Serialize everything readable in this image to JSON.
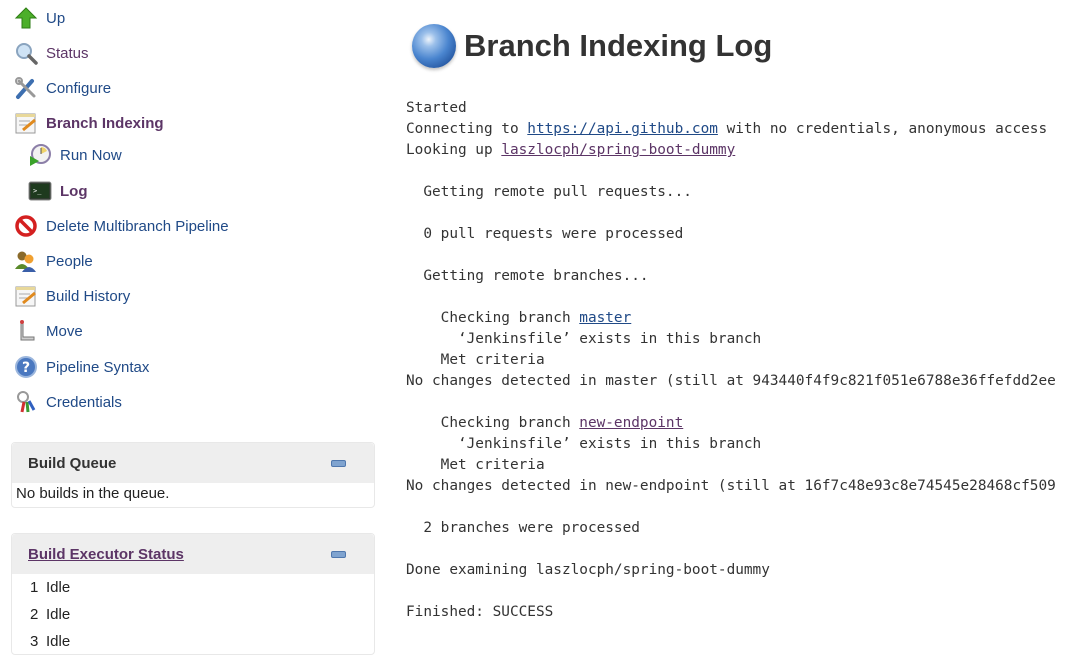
{
  "sidebar": {
    "tasks": [
      {
        "label": "Up",
        "icon": "up-arrow-icon"
      },
      {
        "label": "Status",
        "icon": "magnifier-icon"
      },
      {
        "label": "Configure",
        "icon": "wrench-screwdriver-icon"
      },
      {
        "label": "Branch Indexing",
        "icon": "notepad-icon"
      },
      {
        "label": "Run Now",
        "icon": "clock-play-icon"
      },
      {
        "label": "Log",
        "icon": "terminal-icon"
      },
      {
        "label": "Delete Multibranch Pipeline",
        "icon": "no-entry-icon"
      },
      {
        "label": "People",
        "icon": "people-icon"
      },
      {
        "label": "Build History",
        "icon": "notepad-icon"
      },
      {
        "label": "Move",
        "icon": "move-icon"
      },
      {
        "label": "Pipeline Syntax",
        "icon": "help-icon"
      },
      {
        "label": "Credentials",
        "icon": "keys-icon"
      }
    ]
  },
  "build_queue": {
    "title": "Build Queue",
    "empty_text": "No builds in the queue."
  },
  "executors": {
    "title": "Build Executor Status",
    "rows": [
      {
        "num": "1",
        "status": "Idle"
      },
      {
        "num": "2",
        "status": "Idle"
      },
      {
        "num": "3",
        "status": "Idle"
      }
    ]
  },
  "main": {
    "title": "Branch Indexing Log",
    "log": {
      "started": "Started",
      "connecting_pre": "Connecting to ",
      "connecting_link": "https://api.github.com",
      "connecting_post": " with no credentials, anonymous access",
      "lookup_pre": "Looking up ",
      "lookup_link": "laszlocph/spring-boot-dummy",
      "pr_get": "  Getting remote pull requests...",
      "pr_done": "  0 pull requests were processed",
      "br_get": "  Getting remote branches...",
      "b1_check_pre": "    Checking branch ",
      "b1_link": "master",
      "b1_exists": "      ‘Jenkinsfile’ exists in this branch",
      "b1_met": "    Met criteria",
      "b1_nochange": "No changes detected in master (still at 943440f4f9c821f051e6788e36ffefdd2ee",
      "b2_check_pre": "    Checking branch ",
      "b2_link": "new-endpoint",
      "b2_exists": "      ‘Jenkinsfile’ exists in this branch",
      "b2_met": "    Met criteria",
      "b2_nochange": "No changes detected in new-endpoint (still at 16f7c48e93c8e74545e28468cf509",
      "br_done": "  2 branches were processed",
      "done": "Done examining laszlocph/spring-boot-dummy",
      "finished": "Finished: SUCCESS"
    }
  }
}
